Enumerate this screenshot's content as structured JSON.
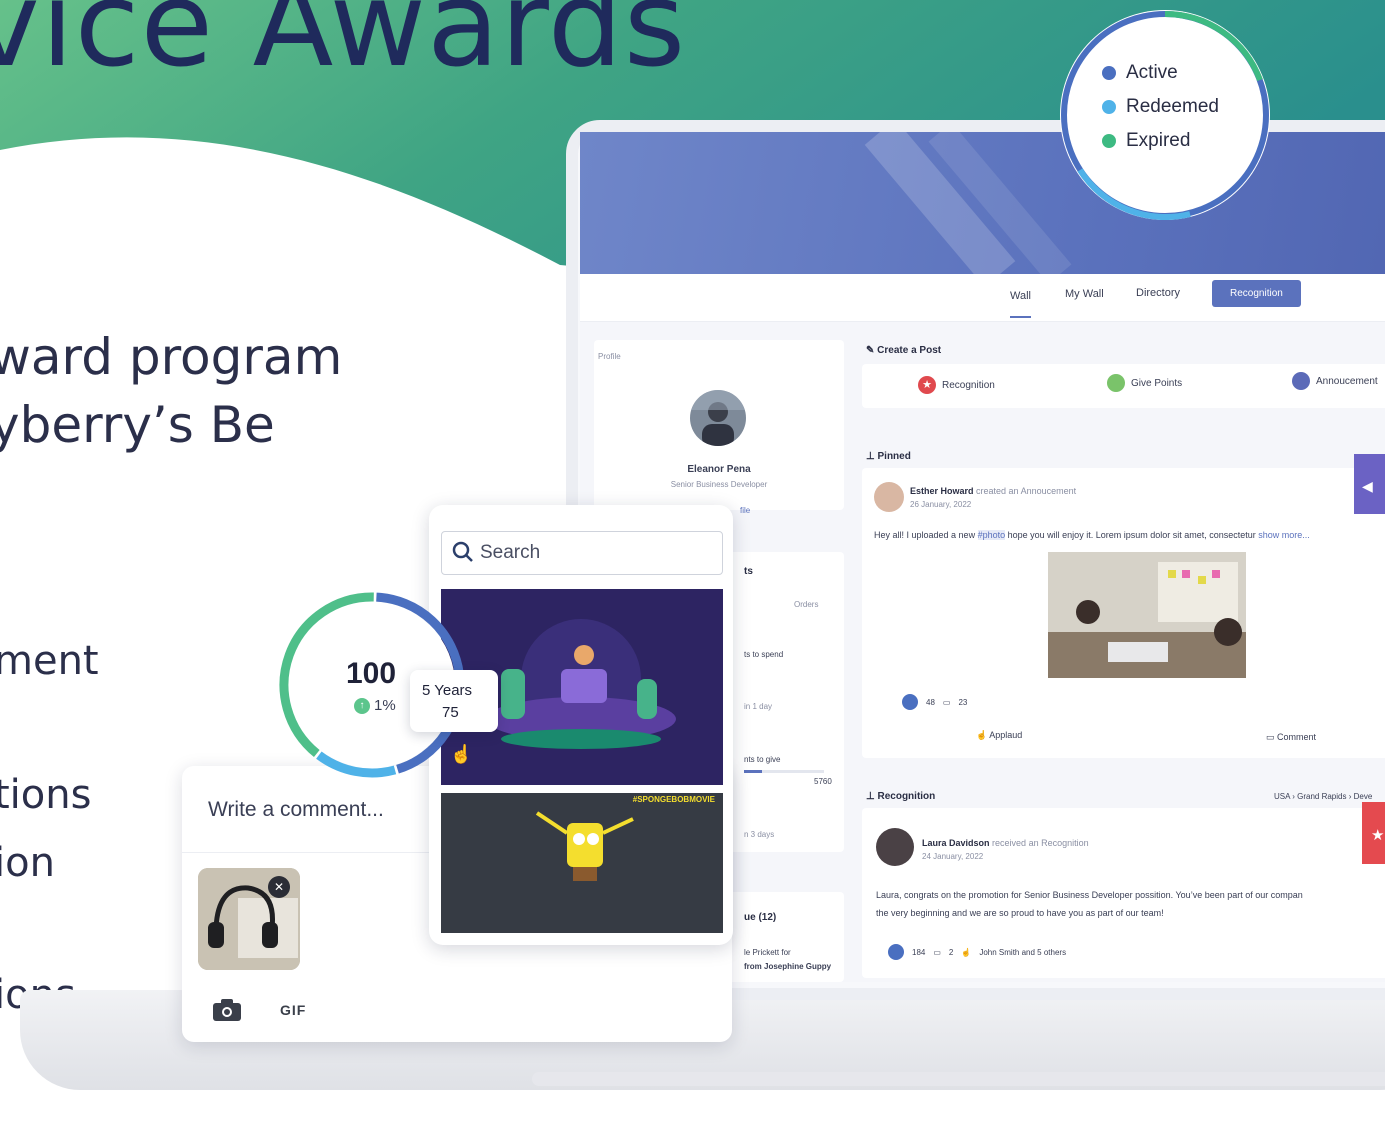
{
  "hero": {
    "title": "vice Awards",
    "subtitle_line1": "ward program",
    "subtitle_line2": "yberry’s Be",
    "features": [
      "ment",
      "tions",
      "ion",
      "ions"
    ]
  },
  "legend": {
    "items": [
      {
        "label": "Active",
        "color": "#4a6fc0"
      },
      {
        "label": "Redeemed",
        "color": "#4fb2e8"
      },
      {
        "label": "Expired",
        "color": "#3dba82"
      }
    ]
  },
  "app": {
    "nav": {
      "tabs": [
        "Wall",
        "My Wall",
        "Directory"
      ],
      "active_button": "Recognition"
    },
    "profile": {
      "section_label": "Profile",
      "name": "Eleanor Pena",
      "role": "Senior Business Developer",
      "link_fragment": "file"
    },
    "points_panel": {
      "title_fragment": "ts",
      "orders_label": "Orders",
      "to_spend": "ts to spend",
      "in_1_day": "in 1 day",
      "to_give": "nts to give",
      "to_give_value": "5760",
      "in_3_days": "n 3 days",
      "queue_label": "ue (12)",
      "queue_line1": "le Prickett for",
      "queue_line2": "from Josephine Guppy"
    },
    "create_post": {
      "title": "Create a Post",
      "options": [
        "Recognition",
        "Give Points",
        "Annoucement"
      ]
    },
    "pinned": {
      "section_title": "Pinned",
      "author": "Esther Howard",
      "action": "created an Annoucement",
      "date": "26 January, 2022",
      "text_before": "Hey all! I uploaded a new",
      "hashtag": "#photo",
      "text_after": "hope you will enjoy it. Lorem ipsum dolor sit amet, consectetur",
      "show_more": "show more...",
      "reactions": "48",
      "comments": "23",
      "applaud_label": "Applaud",
      "comment_label": "Comment"
    },
    "recognition": {
      "section_title": "Recognition",
      "breadcrumb": "USA › Grand Rapids › Deve",
      "author": "Laura Davidson",
      "action": "received an Recognition",
      "date": "24 January, 2022",
      "text_line1": "Laura, congrats on the promotion for Senior Business Developer possition. You’ve been part of our compan",
      "text_line2": "the very beginning and we are so proud to have you as part of our team!",
      "reactions": "184",
      "comments": "2",
      "applauders": "John Smith and 5 others"
    }
  },
  "gif_picker": {
    "search_placeholder": "Search",
    "gif2_caption": "#SPONGEBOBMOVIE"
  },
  "comment_box": {
    "placeholder": "Write a comment...",
    "gif_label": "GIF"
  },
  "donut": {
    "center_value": "100",
    "change": "1%",
    "tooltip_label": "5 Years",
    "tooltip_value": "75",
    "segments": [
      {
        "value": 45,
        "color": "#4a6fc0"
      },
      {
        "value": 15,
        "color": "#4fb2e8"
      },
      {
        "value": 40,
        "color": "#4fbf8a"
      }
    ]
  }
}
